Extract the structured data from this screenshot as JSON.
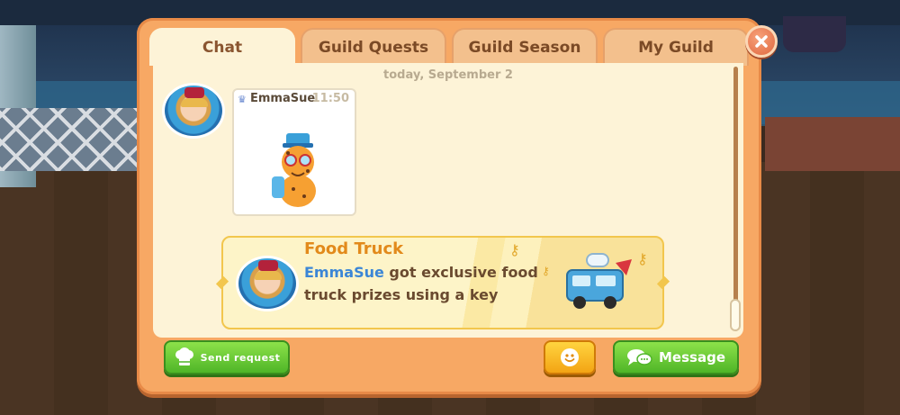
{
  "tabs": [
    {
      "label": "Chat",
      "active": true
    },
    {
      "label": "Guild Quests",
      "active": false
    },
    {
      "label": "Guild Season",
      "active": false
    },
    {
      "label": "My Guild",
      "active": false
    }
  ],
  "chat": {
    "date_separator": "today, September 2",
    "message": {
      "sender": "EmmaSue",
      "time": "11:50",
      "content_type": "sticker",
      "sticker_icon": "cheetah-sticker-icon"
    },
    "event": {
      "title": "Food Truck",
      "player": "EmmaSue",
      "text": "got exclusive food truck prizes using a key",
      "icon": "food-truck-icon"
    }
  },
  "buttons": {
    "send_request": "Send request",
    "emoji": "emoji-icon",
    "message": "Message"
  },
  "colors": {
    "panel": "#f7a864",
    "chat_bg": "#fdf3d7",
    "accent_green": "#4fb528",
    "event_title": "#e28a1b",
    "player_name": "#3b86d6"
  }
}
